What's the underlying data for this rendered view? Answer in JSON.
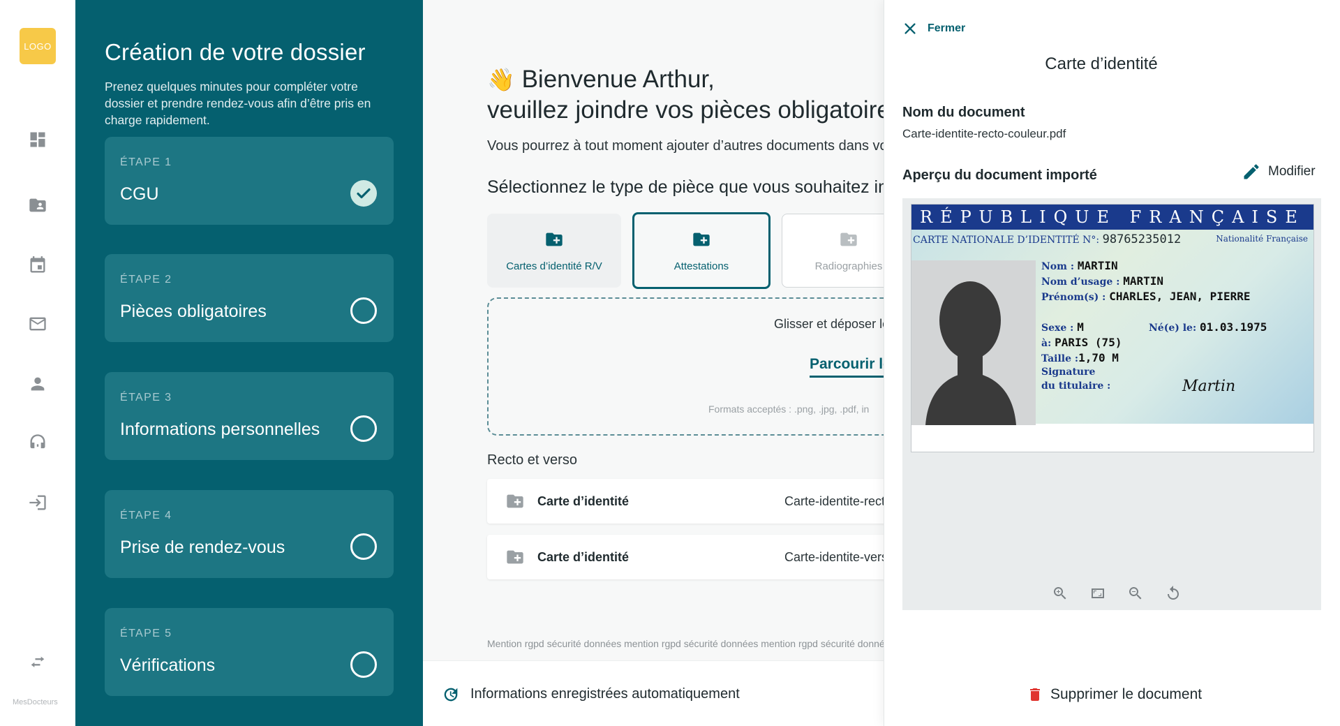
{
  "rail": {
    "logo": "LOGO",
    "brand": "MesDocteurs",
    "icons": [
      "dashboard-icon",
      "folder-user-icon",
      "calendar-icon",
      "mail-icon",
      "person-icon",
      "support-agent-icon",
      "login-icon",
      "swap-icon"
    ]
  },
  "steps_panel": {
    "title": "Création de votre dossier",
    "intro": "Prenez quelques minutes pour compléter votre dossier et prendre rendez-vous afin d’être pris en charge rapidement.",
    "steps": [
      {
        "number": "ÉTAPE 1",
        "title": "CGU",
        "status": "done"
      },
      {
        "number": "ÉTAPE 2",
        "title": "Pièces obligatoires",
        "status": "todo"
      },
      {
        "number": "ÉTAPE 3",
        "title": "Informations personnelles",
        "status": "todo"
      },
      {
        "number": "ÉTAPE 4",
        "title": "Prise de rendez-vous",
        "status": "todo"
      },
      {
        "number": "ÉTAPE 5",
        "title": "Vérifications",
        "status": "todo"
      }
    ]
  },
  "main": {
    "greeting_line1": "Bienvenue Arthur,",
    "greeting_line2": "veuillez joindre vos pièces obligatoires",
    "subtitle": "Vous pourrez à tout moment ajouter d’autres documents dans votre espace",
    "select_prompt": "Sélectionnez le type de pièce que vous souhaitez importer",
    "types": [
      {
        "label": "Cartes d’identité R/V",
        "icon": "folder-add-icon",
        "state": "default"
      },
      {
        "label": "Attestations",
        "icon": "folder-add-icon",
        "state": "selected"
      },
      {
        "label": "Radiographies",
        "icon": "folder-add-icon",
        "state": "outlined"
      }
    ],
    "drop": {
      "text": "Glisser et déposer les fichiers ici",
      "browse": "Parcourir les fichiers",
      "formats": "Formats acceptés : .png, .jpg, .pdf, in"
    },
    "recto_label": "Recto et verso",
    "documents": [
      {
        "name": "Carte d’identité",
        "file": "Carte-identite-recto-couleur.pdf"
      },
      {
        "name": "Carte d’identité",
        "file": "Carte-identite-verso-couleur.pdf"
      }
    ],
    "mention": "Mention rgpd sécurité données mention rgpd sécurité données mention rgpd sécurité données",
    "autosave": "Informations enregistrées automatiquement"
  },
  "drawer": {
    "close_label": "Fermer",
    "title": "Carte d’identité",
    "doc_name_label": "Nom du document",
    "doc_name_value": "Carte-identite-recto-couleur.pdf",
    "preview_label": "Aperçu du document importé",
    "edit_label": "Modifier",
    "delete_label": "Supprimer le document",
    "card": {
      "band": "RÉPUBLIQUE FRANÇAISE",
      "card_no_label": "CARTE NATIONALE D’IDENTITÉ N°:",
      "card_no": "98765235012",
      "nationality": "Nationalité Française",
      "nom_label": "Nom :",
      "nom": "MARTIN",
      "usage_label": "Nom d’usage :",
      "usage": "MARTIN",
      "prenoms_label": "Prénom(s) :",
      "prenoms": "CHARLES, JEAN, PIERRE",
      "sexe_label": "Sexe :",
      "sexe": "M",
      "ne_label": "Né(e) le:",
      "ne": "01.03.1975",
      "a_label": "à:",
      "a": "PARIS (75)",
      "taille_label": "Taille :",
      "taille": "1,70 M",
      "signature_label1": "Signature",
      "signature_label2": "du titulaire :",
      "signature": "Martin"
    },
    "tools": [
      "zoom-in-icon",
      "fit-screen-icon",
      "zoom-out-icon",
      "rotate-icon"
    ]
  },
  "colors": {
    "primary": "#05606f",
    "step_card": "#1d7683",
    "logo": "#f7c948",
    "danger": "#e0342f"
  }
}
